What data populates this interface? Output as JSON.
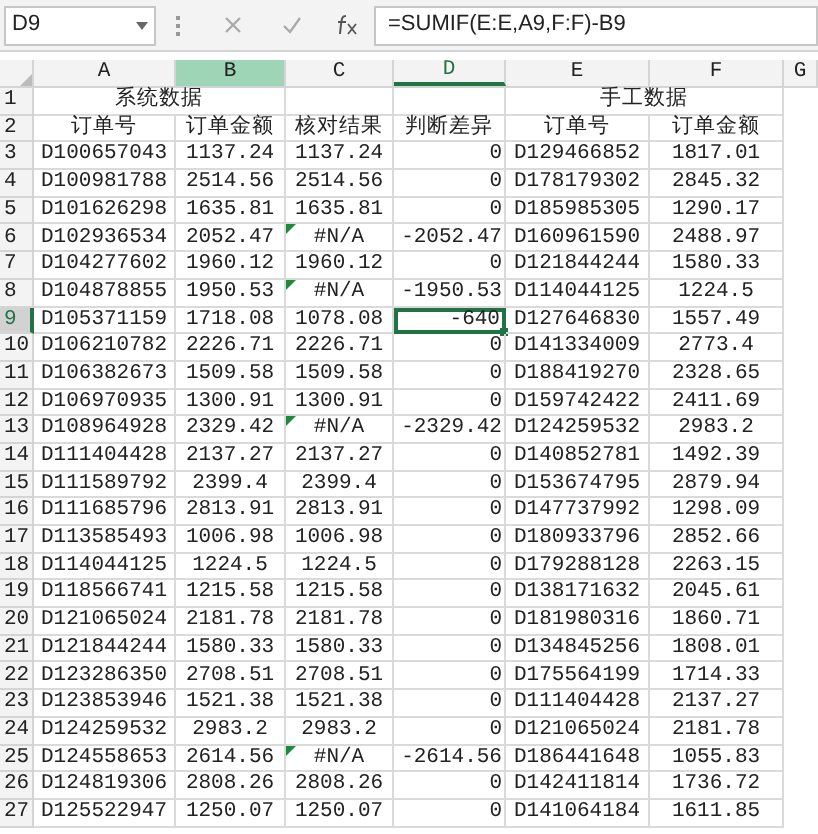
{
  "formula_bar": {
    "name_box": "D9",
    "formula": "=SUMIF(E:E,A9,F:F)-B9"
  },
  "columns": [
    {
      "label": "A",
      "selected": false,
      "highlighted": false
    },
    {
      "label": "B",
      "selected": false,
      "highlighted": true
    },
    {
      "label": "C",
      "selected": false,
      "highlighted": false
    },
    {
      "label": "D",
      "selected": true,
      "highlighted": false
    },
    {
      "label": "E",
      "selected": false,
      "highlighted": false
    },
    {
      "label": "F",
      "selected": false,
      "highlighted": false
    },
    {
      "label": "G",
      "selected": false,
      "highlighted": false
    }
  ],
  "title_row": {
    "number": "1",
    "left": "系统数据",
    "right": "手工数据"
  },
  "rows": [
    {
      "number": "2",
      "selected": false,
      "flagged": false,
      "cells": [
        "订单号",
        "订单金额",
        "核对结果",
        "判断差异",
        "订单号",
        "订单金额"
      ]
    },
    {
      "number": "3",
      "selected": false,
      "flagged": false,
      "cells": [
        "D100657043",
        "1137.24",
        "1137.24",
        "0",
        "D129466852",
        "1817.01"
      ]
    },
    {
      "number": "4",
      "selected": false,
      "flagged": false,
      "cells": [
        "D100981788",
        "2514.56",
        "2514.56",
        "0",
        "D178179302",
        "2845.32"
      ]
    },
    {
      "number": "5",
      "selected": false,
      "flagged": false,
      "cells": [
        "D101626298",
        "1635.81",
        "1635.81",
        "0",
        "D185985305",
        "1290.17"
      ]
    },
    {
      "number": "6",
      "selected": false,
      "flagged": true,
      "cells": [
        "D102936534",
        "2052.47",
        "#N/A",
        "-2052.47",
        "D160961590",
        "2488.97"
      ]
    },
    {
      "number": "7",
      "selected": false,
      "flagged": false,
      "cells": [
        "D104277602",
        "1960.12",
        "1960.12",
        "0",
        "D121844244",
        "1580.33"
      ]
    },
    {
      "number": "8",
      "selected": false,
      "flagged": true,
      "cells": [
        "D104878855",
        "1950.53",
        "#N/A",
        "-1950.53",
        "D114044125",
        "1224.5"
      ]
    },
    {
      "number": "9",
      "selected": true,
      "flagged": false,
      "cells": [
        "D105371159",
        "1718.08",
        "1078.08",
        "-640",
        "D127646830",
        "1557.49"
      ]
    },
    {
      "number": "10",
      "selected": false,
      "flagged": false,
      "cells": [
        "D106210782",
        "2226.71",
        "2226.71",
        "0",
        "D141334009",
        "2773.4"
      ]
    },
    {
      "number": "11",
      "selected": false,
      "flagged": false,
      "cells": [
        "D106382673",
        "1509.58",
        "1509.58",
        "0",
        "D188419270",
        "2328.65"
      ]
    },
    {
      "number": "12",
      "selected": false,
      "flagged": false,
      "cells": [
        "D106970935",
        "1300.91",
        "1300.91",
        "0",
        "D159742422",
        "2411.69"
      ]
    },
    {
      "number": "13",
      "selected": false,
      "flagged": true,
      "cells": [
        "D108964928",
        "2329.42",
        "#N/A",
        "-2329.42",
        "D124259532",
        "2983.2"
      ]
    },
    {
      "number": "14",
      "selected": false,
      "flagged": false,
      "cells": [
        "D111404428",
        "2137.27",
        "2137.27",
        "0",
        "D140852781",
        "1492.39"
      ]
    },
    {
      "number": "15",
      "selected": false,
      "flagged": false,
      "cells": [
        "D111589792",
        "2399.4",
        "2399.4",
        "0",
        "D153674795",
        "2879.94"
      ]
    },
    {
      "number": "16",
      "selected": false,
      "flagged": false,
      "cells": [
        "D111685796",
        "2813.91",
        "2813.91",
        "0",
        "D147737992",
        "1298.09"
      ]
    },
    {
      "number": "17",
      "selected": false,
      "flagged": false,
      "cells": [
        "D113585493",
        "1006.98",
        "1006.98",
        "0",
        "D180933796",
        "2852.66"
      ]
    },
    {
      "number": "18",
      "selected": false,
      "flagged": false,
      "cells": [
        "D114044125",
        "1224.5",
        "1224.5",
        "0",
        "D179288128",
        "2263.15"
      ]
    },
    {
      "number": "19",
      "selected": false,
      "flagged": false,
      "cells": [
        "D118566741",
        "1215.58",
        "1215.58",
        "0",
        "D138171632",
        "2045.61"
      ]
    },
    {
      "number": "20",
      "selected": false,
      "flagged": false,
      "cells": [
        "D121065024",
        "2181.78",
        "2181.78",
        "0",
        "D181980316",
        "1860.71"
      ]
    },
    {
      "number": "21",
      "selected": false,
      "flagged": false,
      "cells": [
        "D121844244",
        "1580.33",
        "1580.33",
        "0",
        "D134845256",
        "1808.01"
      ]
    },
    {
      "number": "22",
      "selected": false,
      "flagged": false,
      "cells": [
        "D123286350",
        "2708.51",
        "2708.51",
        "0",
        "D175564199",
        "1714.33"
      ]
    },
    {
      "number": "23",
      "selected": false,
      "flagged": false,
      "cells": [
        "D123853946",
        "1521.38",
        "1521.38",
        "0",
        "D111404428",
        "2137.27"
      ]
    },
    {
      "number": "24",
      "selected": false,
      "flagged": false,
      "cells": [
        "D124259532",
        "2983.2",
        "2983.2",
        "0",
        "D121065024",
        "2181.78"
      ]
    },
    {
      "number": "25",
      "selected": false,
      "flagged": true,
      "cells": [
        "D124558653",
        "2614.56",
        "#N/A",
        "-2614.56",
        "D186441648",
        "1055.83"
      ]
    },
    {
      "number": "26",
      "selected": false,
      "flagged": false,
      "cells": [
        "D124819306",
        "2808.26",
        "2808.26",
        "0",
        "D142411814",
        "1736.72"
      ]
    },
    {
      "number": "27",
      "selected": false,
      "flagged": false,
      "cells": [
        "D125522947",
        "1250.07",
        "1250.07",
        "0",
        "D141064184",
        "1611.85"
      ]
    }
  ]
}
